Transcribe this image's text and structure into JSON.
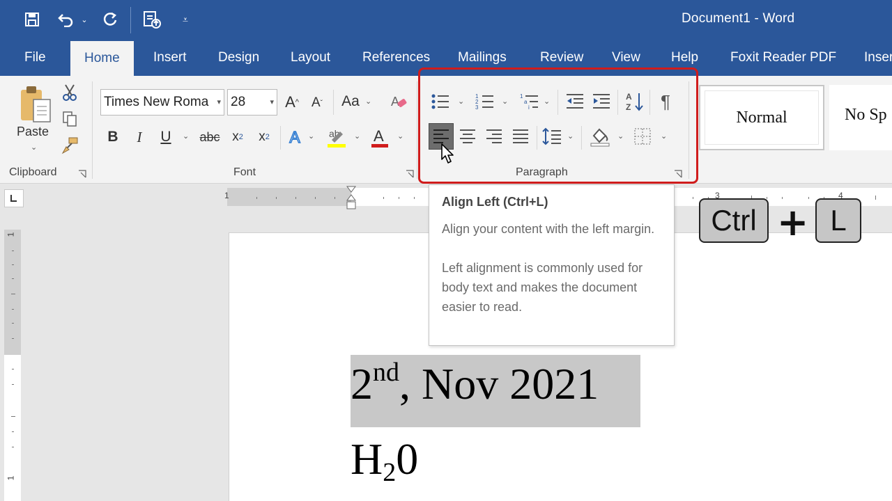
{
  "window": {
    "title": "Document1  -  Word"
  },
  "tabs": [
    "File",
    "Home",
    "Insert",
    "Design",
    "Layout",
    "References",
    "Mailings",
    "Review",
    "View",
    "Help",
    "Foxit Reader PDF",
    "Inser"
  ],
  "clipboard": {
    "paste_label": "Paste",
    "group_label": "Clipboard"
  },
  "font": {
    "name": "Times New Roma",
    "size": "28",
    "aa_label": "Aa",
    "group_label": "Font"
  },
  "paragraph": {
    "group_label": "Paragraph"
  },
  "styles": {
    "normal": "Normal",
    "no_spacing": "No Sp"
  },
  "ruler": {
    "h_marks": [
      "1",
      "3",
      "4"
    ],
    "v_marks": [
      "1",
      "1"
    ]
  },
  "tooltip": {
    "title": "Align Left (Ctrl+L)",
    "desc1": "Align your content with the left margin.",
    "desc2": "Left alignment is commonly used for body text and makes the document easier to read."
  },
  "document": {
    "date_prefix": "2",
    "date_sup": "nd",
    "date_rest": ", Nov 2021",
    "h_text": "H",
    "h_sub": "2",
    "h_tail": "0"
  },
  "shortcut": {
    "key1": "Ctrl",
    "plus": "+",
    "key2": "L"
  },
  "colors": {
    "accent": "#2b579a",
    "highlight_box": "#d01c1c",
    "font_color_bar": "#d01c1c",
    "highlight_bar": "#ffff00"
  }
}
